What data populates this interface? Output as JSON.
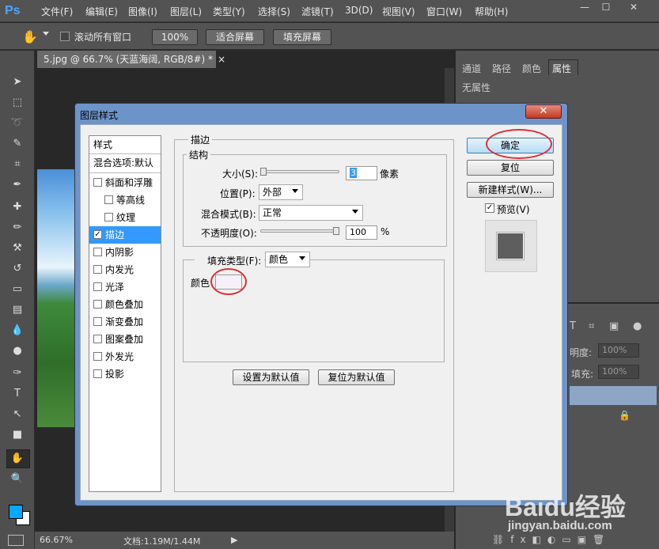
{
  "app": {
    "logo": "Ps"
  },
  "menu": [
    "文件(F)",
    "编辑(E)",
    "图像(I)",
    "图层(L)",
    "类型(Y)",
    "选择(S)",
    "滤镜(T)",
    "3D(D)",
    "视图(V)",
    "窗口(W)",
    "帮助(H)"
  ],
  "window_buttons": [
    "—",
    "☐",
    "✕"
  ],
  "options_bar": {
    "scroll_all_label": "滚动所有窗口",
    "zoom_100": "100%",
    "fit_screen": "适合屏幕",
    "fill_screen": "填充屏幕"
  },
  "document": {
    "tab_title": "5.jpg @ 66.7% (天蓝海阔, RGB/8#) *",
    "zoom": "66.67%",
    "doc_size": "文档:1.19M/1.44M"
  },
  "panels": {
    "tabs": [
      "通道",
      "路径",
      "颜色",
      "属性"
    ],
    "active_tab": "属性",
    "no_properties": "无属性",
    "opacity_label": "明度:",
    "opacity_value": "100%",
    "fill_label": "填充:",
    "fill_value": "100%"
  },
  "dialog": {
    "title": "图层样式",
    "close": "✕",
    "styles_header": "样式",
    "blend_options": "混合选项:默认",
    "style_items": [
      {
        "label": "斜面和浮雕",
        "checked": false
      },
      {
        "label": "等高线",
        "checked": false
      },
      {
        "label": "纹理",
        "checked": false
      },
      {
        "label": "描边",
        "checked": true
      },
      {
        "label": "内阴影",
        "checked": false
      },
      {
        "label": "内发光",
        "checked": false
      },
      {
        "label": "光泽",
        "checked": false
      },
      {
        "label": "颜色叠加",
        "checked": false
      },
      {
        "label": "渐变叠加",
        "checked": false
      },
      {
        "label": "图案叠加",
        "checked": false
      },
      {
        "label": "外发光",
        "checked": false
      },
      {
        "label": "投影",
        "checked": false
      }
    ],
    "stroke": {
      "section_title": "描边",
      "structure_title": "结构",
      "size_label": "大小(S):",
      "size_value": "3",
      "size_unit": "像素",
      "position_label": "位置(P):",
      "position_value": "外部",
      "blend_mode_label": "混合模式(B):",
      "blend_mode_value": "正常",
      "opacity_label": "不透明度(O):",
      "opacity_value": "100",
      "opacity_unit": "%",
      "opacity_level": 1.0,
      "size_level": 0.0,
      "fill_type_label": "填充类型(F):",
      "fill_type_value": "颜色",
      "color_label": "颜色",
      "color_swatch": "#f6f1f8"
    },
    "buttons": {
      "set_default": "设置为默认值",
      "reset_default": "复位为默认值",
      "ok": "确定",
      "reset": "复位",
      "new_style": "新建样式(W)...",
      "preview": "预览(V)",
      "preview_checked": true
    }
  },
  "watermark": {
    "logo": "Baidu经验",
    "url": "jingyan.baidu.com"
  },
  "colors": {
    "highlight_circle": "#d9303b",
    "selection": "#3399ff",
    "foreground": "#00aaff",
    "background": "#ffffff"
  }
}
